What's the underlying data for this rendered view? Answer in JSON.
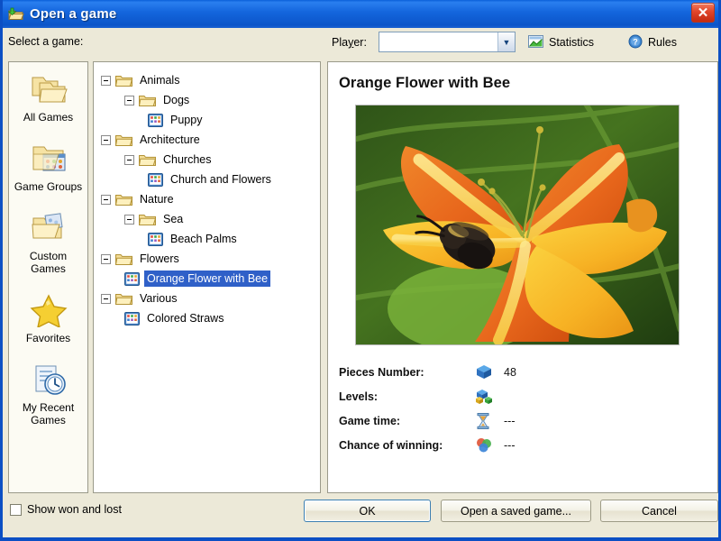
{
  "window": {
    "title": "Open a game",
    "title_icon": "open-folder-icon",
    "close_label": "✕",
    "accent_color": "#1466dd",
    "selection_color": "#2f60c8",
    "face_color": "#ece9d8"
  },
  "toolbar": {
    "select_label": "Select a game:",
    "player_label_pre": "Pla",
    "player_label_accel": "y",
    "player_label_post": "er:",
    "player_value": "",
    "player_placeholder": "",
    "statistics_label": "Statistics",
    "statistics_icon": "chart-icon",
    "rules_label": "Rules",
    "rules_icon": "help-circle-icon"
  },
  "sidebar": {
    "items": [
      {
        "label": "All Games",
        "icon": "folders-icon"
      },
      {
        "label": "Game Groups",
        "icon": "folder-groups-icon"
      },
      {
        "label": "Custom Games",
        "icon": "folder-custom-icon"
      },
      {
        "label": "Favorites",
        "icon": "star-icon"
      },
      {
        "label": "My Recent Games",
        "icon": "recent-clock-icon"
      }
    ]
  },
  "tree": {
    "nodes": [
      {
        "label": "Animals",
        "type": "folder",
        "depth": 0,
        "expanded": true,
        "selected": false
      },
      {
        "label": "Dogs",
        "type": "folder",
        "depth": 1,
        "expanded": true,
        "selected": false
      },
      {
        "label": "Puppy",
        "type": "game",
        "depth": 2,
        "expanded": false,
        "selected": false
      },
      {
        "label": "Architecture",
        "type": "folder",
        "depth": 0,
        "expanded": true,
        "selected": false
      },
      {
        "label": "Churches",
        "type": "folder",
        "depth": 1,
        "expanded": true,
        "selected": false
      },
      {
        "label": "Church and Flowers",
        "type": "game",
        "depth": 2,
        "expanded": false,
        "selected": false
      },
      {
        "label": "Nature",
        "type": "folder",
        "depth": 0,
        "expanded": true,
        "selected": false
      },
      {
        "label": "Sea",
        "type": "folder",
        "depth": 1,
        "expanded": true,
        "selected": false
      },
      {
        "label": "Beach Palms",
        "type": "game",
        "depth": 2,
        "expanded": false,
        "selected": false
      },
      {
        "label": "Flowers",
        "type": "folder",
        "depth": 0,
        "expanded": true,
        "selected": false
      },
      {
        "label": "Orange Flower with Bee",
        "type": "game",
        "depth": 1,
        "expanded": false,
        "selected": true
      },
      {
        "label": "Various",
        "type": "folder",
        "depth": 0,
        "expanded": true,
        "selected": false
      },
      {
        "label": "Colored Straws",
        "type": "game",
        "depth": 1,
        "expanded": false,
        "selected": false
      }
    ]
  },
  "detail": {
    "title": "Orange Flower with Bee",
    "preview_alt": "orange daylily flower with black bee",
    "meta": [
      {
        "label": "Pieces Number:",
        "icon": "blue-cube-icon",
        "value": "48"
      },
      {
        "label": "Levels:",
        "icon": "colored-cubes-icon",
        "value": ""
      },
      {
        "label": "Game time:",
        "icon": "hourglass-icon",
        "value": "---"
      },
      {
        "label": "Chance of winning:",
        "icon": "color-circles-icon",
        "value": "---"
      }
    ]
  },
  "bottom": {
    "checkbox_label": "Show won and lost",
    "checkbox_checked": false,
    "ok_label": "OK",
    "saved_label": "Open a saved game...",
    "cancel_label": "Cancel"
  }
}
